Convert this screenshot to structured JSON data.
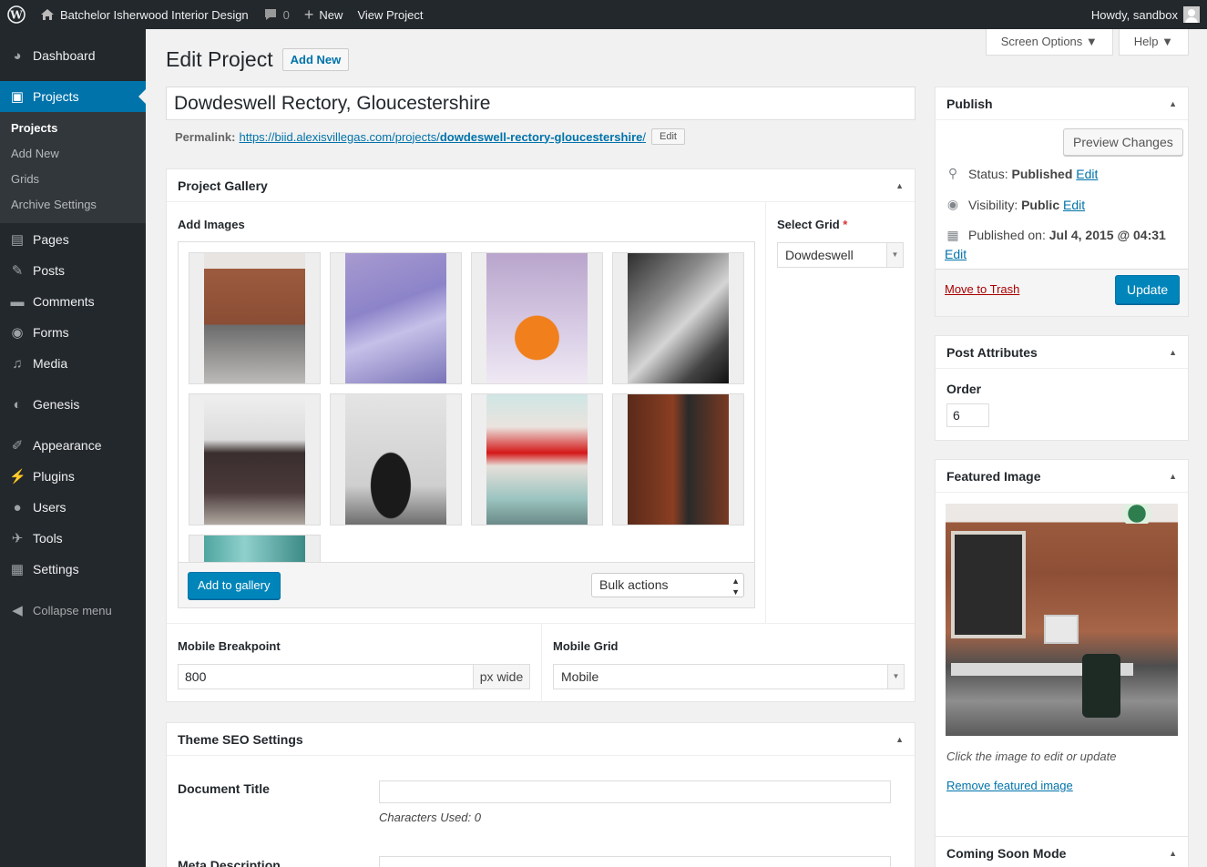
{
  "adminbar": {
    "site_name": "Batchelor Isherwood Interior Design",
    "comments_count": "0",
    "new_label": "New",
    "view_label": "View Project",
    "howdy": "Howdy, sandbox"
  },
  "menu": {
    "dashboard": "Dashboard",
    "projects": "Projects",
    "sub": [
      "Projects",
      "Add New",
      "Grids",
      "Archive Settings"
    ],
    "pages": "Pages",
    "posts": "Posts",
    "comments": "Comments",
    "forms": "Forms",
    "media": "Media",
    "genesis": "Genesis",
    "appearance": "Appearance",
    "plugins": "Plugins",
    "users": "Users",
    "tools": "Tools",
    "settings": "Settings",
    "collapse": "Collapse menu"
  },
  "screen_meta": {
    "screen_options": "Screen Options ▼",
    "help": "Help ▼"
  },
  "page": {
    "title": "Edit Project",
    "add_new": "Add New",
    "post_title": "Dowdeswell Rectory, Gloucestershire",
    "permalink_label": "Permalink:",
    "permalink_base": "https://biid.alexisvillegas.com/projects/",
    "permalink_slug": "dowdeswell-rectory-gloucestershire",
    "permalink_end": "/",
    "permalink_edit": "Edit"
  },
  "gallery": {
    "heading": "Project Gallery",
    "add_images": "Add Images",
    "select_grid_label": "Select Grid",
    "required_mark": "*",
    "select_grid_value": "Dowdeswell",
    "add_to_gallery": "Add to gallery",
    "bulk_actions": "Bulk actions",
    "mobile_breakpoint_label": "Mobile Breakpoint",
    "mobile_breakpoint_value": "800",
    "mobile_breakpoint_unit": "px wide",
    "mobile_grid_label": "Mobile Grid",
    "mobile_grid_value": "Mobile"
  },
  "seo": {
    "heading": "Theme SEO Settings",
    "document_title": "Document Title",
    "characters_used": "Characters Used: 0",
    "meta_description": "Meta Description"
  },
  "publish": {
    "heading": "Publish",
    "preview": "Preview Changes",
    "status_label": "Status:",
    "status_value": "Published",
    "visibility_label": "Visibility:",
    "visibility_value": "Public",
    "published_on_label": "Published on:",
    "published_on_value": "Jul 4, 2015 @ 04:31",
    "edit": "Edit",
    "trash": "Move to Trash",
    "update": "Update"
  },
  "attributes": {
    "heading": "Post Attributes",
    "order_label": "Order",
    "order_value": "6"
  },
  "featured": {
    "heading": "Featured Image",
    "hint": "Click the image to edit or update",
    "remove": "Remove featured image"
  },
  "coming_soon": {
    "heading": "Coming Soon Mode"
  }
}
